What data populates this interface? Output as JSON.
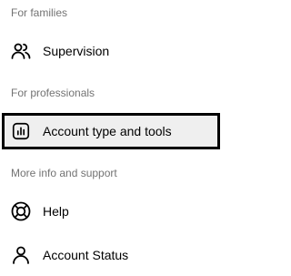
{
  "sections": {
    "families": {
      "header": "For families",
      "items": [
        {
          "label": "Supervision",
          "icon": "supervision-icon"
        }
      ]
    },
    "professionals": {
      "header": "For professionals",
      "items": [
        {
          "label": "Account type and tools",
          "icon": "insights-chart-icon",
          "selected": true
        }
      ]
    },
    "support": {
      "header": "More info and support",
      "items": [
        {
          "label": "Help",
          "icon": "lifebuoy-icon"
        },
        {
          "label": "Account Status",
          "icon": "person-icon"
        }
      ]
    }
  },
  "colors": {
    "header_text": "#737373",
    "item_text": "#000000",
    "selected_background": "#efefef",
    "selected_border": "#000000"
  }
}
